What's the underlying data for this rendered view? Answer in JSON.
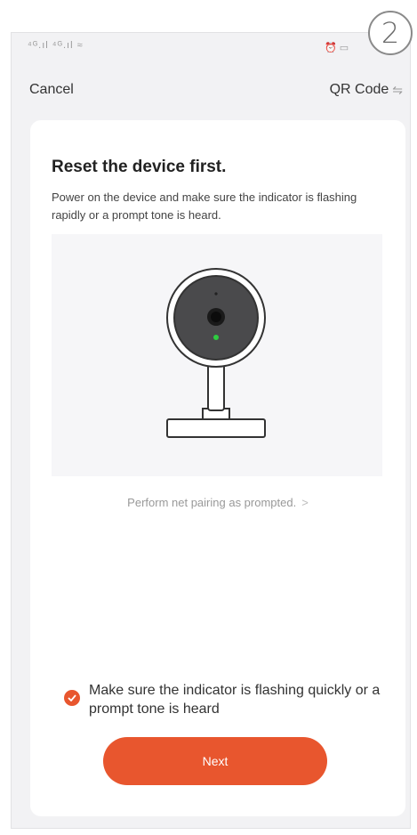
{
  "step_badge": "2",
  "status_bar": {
    "signal": "⁴ᴳ.ıl ⁴ᴳ.ıl ≈",
    "right": "⏰ ▭"
  },
  "nav": {
    "cancel_label": "Cancel",
    "qr_label": "QR Code",
    "qr_icon": "⇋"
  },
  "card": {
    "title": "Reset the device first.",
    "description": "Power on the device and make sure the indicator is flashing rapidly or a prompt tone is heard.",
    "pairing_link": "Perform net pairing as prompted.",
    "pairing_chevron": ">",
    "confirm_text": "Make sure the indicator is flashing quickly or a prompt tone is heard",
    "confirm_checked": true,
    "next_label": "Next"
  },
  "colors": {
    "accent": "#e8562e",
    "indicator": "#2ecc40"
  }
}
